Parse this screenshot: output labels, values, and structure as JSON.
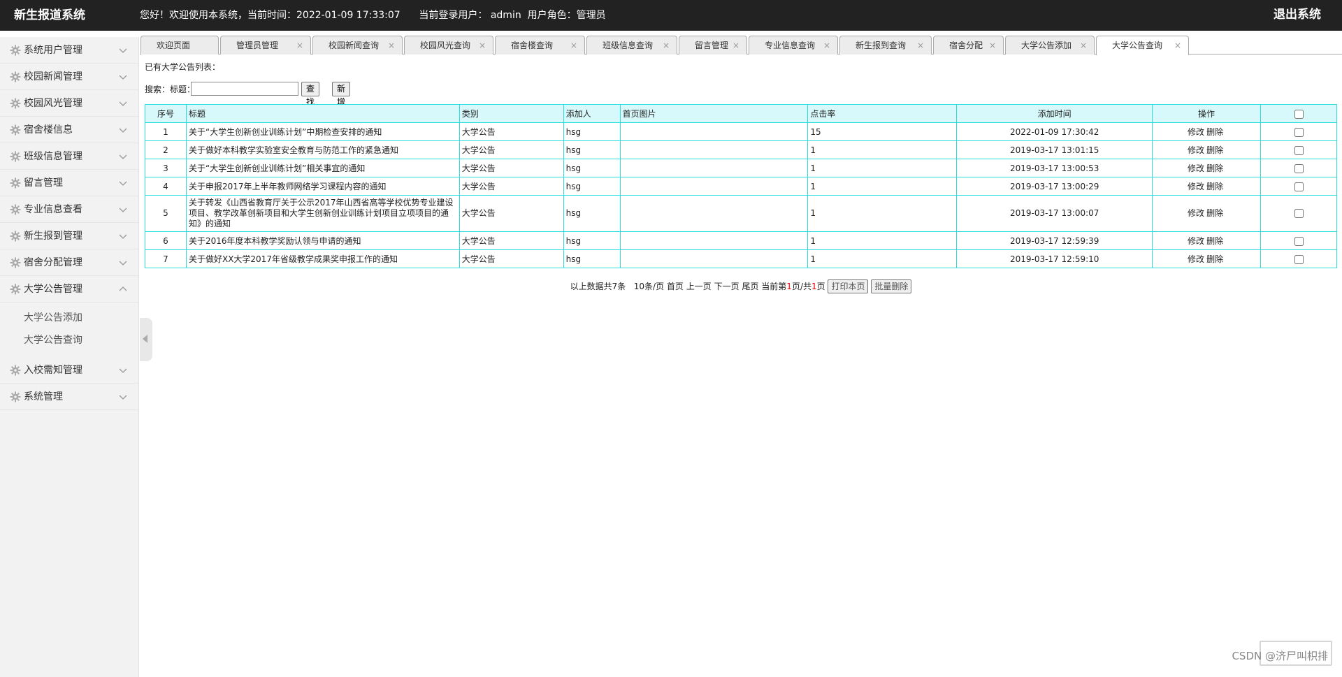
{
  "header": {
    "app_title": "新生报道系统",
    "welcome": "您好！欢迎使用本系统，当前时间：2022-01-09 17:33:07",
    "current_user_label": "当前登录用户：",
    "current_user": "admin",
    "role_label": "用户角色：",
    "role": "管理员",
    "logout_label": "退出系统"
  },
  "sidebar": {
    "items": [
      {
        "label": "系统用户管理"
      },
      {
        "label": "校园新闻管理"
      },
      {
        "label": "校园风光管理"
      },
      {
        "label": "宿舍楼信息"
      },
      {
        "label": "班级信息管理"
      },
      {
        "label": "留言管理"
      },
      {
        "label": "专业信息查看"
      },
      {
        "label": "新生报到管理"
      },
      {
        "label": "宿舍分配管理"
      },
      {
        "label": "大学公告管理"
      },
      {
        "label": "入校需知管理"
      },
      {
        "label": "系统管理"
      }
    ],
    "submenu": [
      "大学公告添加",
      "大学公告查询"
    ]
  },
  "tabs": [
    {
      "label": "欢迎页面",
      "closable": false
    },
    {
      "label": "管理员管理",
      "closable": true
    },
    {
      "label": "校园新闻查询",
      "closable": true
    },
    {
      "label": "校园风光查询",
      "closable": true
    },
    {
      "label": "宿舍楼查询",
      "closable": true
    },
    {
      "label": "班级信息查询",
      "closable": true
    },
    {
      "label": "留言管理",
      "closable": true
    },
    {
      "label": "专业信息查询",
      "closable": true
    },
    {
      "label": "新生报到查询",
      "closable": true
    },
    {
      "label": "宿舍分配",
      "closable": true
    },
    {
      "label": "大学公告添加",
      "closable": true
    },
    {
      "label": "大学公告查询",
      "closable": true
    }
  ],
  "main": {
    "list_title": "已有大学公告列表：",
    "search_label": "搜索：标题：",
    "search_value": "",
    "search_button": "查找",
    "add_button": "新增",
    "columns": [
      "序号",
      "标题",
      "类别",
      "添加人",
      "首页图片",
      "点击率",
      "添加时间",
      "操作"
    ],
    "rows": [
      {
        "no": "1",
        "title": "关于“大学生创新创业训练计划”中期检查安排的通知",
        "category": "大学公告",
        "author": "hsg",
        "image": "",
        "clicks": "15",
        "time": "2022-01-09 17:30:42"
      },
      {
        "no": "2",
        "title": "关于做好本科教学实验室安全教育与防范工作的紧急通知",
        "category": "大学公告",
        "author": "hsg",
        "image": "",
        "clicks": "1",
        "time": "2019-03-17 13:01:15"
      },
      {
        "no": "3",
        "title": "关于“大学生创新创业训练计划”相关事宜的通知",
        "category": "大学公告",
        "author": "hsg",
        "image": "",
        "clicks": "1",
        "time": "2019-03-17 13:00:53"
      },
      {
        "no": "4",
        "title": "关于申报2017年上半年教师网络学习课程内容的通知",
        "category": "大学公告",
        "author": "hsg",
        "image": "",
        "clicks": "1",
        "time": "2019-03-17 13:00:29"
      },
      {
        "no": "5",
        "title": "关于转发《山西省教育厅关于公示2017年山西省高等学校优势专业建设项目、教学改革创新项目和大学生创新创业训练计划项目立项项目的通知》的通知",
        "category": "大学公告",
        "author": "hsg",
        "image": "",
        "clicks": "1",
        "time": "2019-03-17 13:00:07"
      },
      {
        "no": "6",
        "title": "关于2016年度本科教学奖励认领与申请的通知",
        "category": "大学公告",
        "author": "hsg",
        "image": "",
        "clicks": "1",
        "time": "2019-03-17 12:59:39"
      },
      {
        "no": "7",
        "title": "关于做好XX大学2017年省级教学成果奖申报工作的通知",
        "category": "大学公告",
        "author": "hsg",
        "image": "",
        "clicks": "1",
        "time": "2019-03-17 12:59:10"
      }
    ],
    "edit_label": "修改",
    "delete_label": "删除",
    "pager": {
      "summary": "以上数据共7条",
      "page_size": "10条/页",
      "first": "首页",
      "prev": "上一页",
      "next": "下一页",
      "last": "尾页",
      "current_prefix": "当前第",
      "current_page": "1",
      "mid": "页/共",
      "total_pages": "1",
      "suffix": "页",
      "print_button": "打印本页",
      "batch_delete_button": "批量删除"
    }
  },
  "watermark": "CSDN @济尸叫枳排"
}
